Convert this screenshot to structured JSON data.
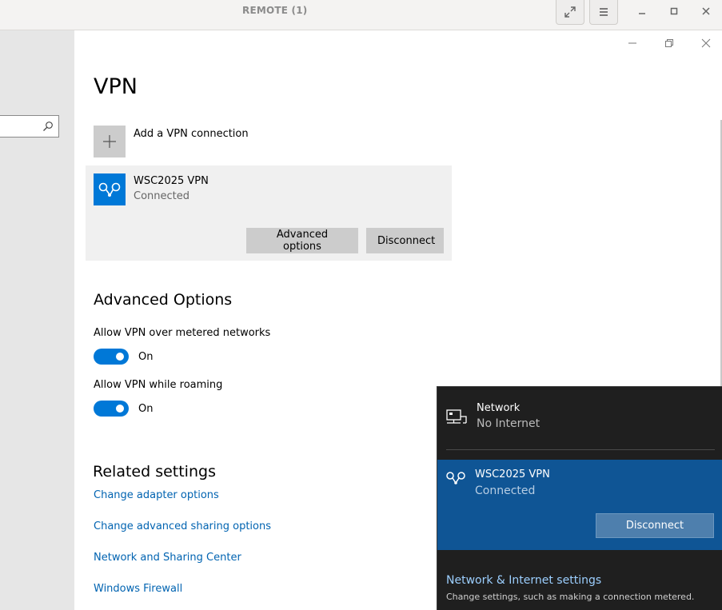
{
  "remote_bar": {
    "title": "REMOTE (1)"
  },
  "page": {
    "title": "VPN",
    "add_vpn_label": "Add a VPN connection",
    "vpn": {
      "name": "WSC2025 VPN",
      "status": "Connected",
      "advanced_button": "Advanced options",
      "disconnect_button": "Disconnect"
    },
    "advanced": {
      "title": "Advanced Options",
      "metered_label": "Allow VPN over metered networks",
      "metered_state": "On",
      "roaming_label": "Allow VPN while roaming",
      "roaming_state": "On"
    },
    "related": {
      "title": "Related settings",
      "links": [
        "Change adapter options",
        "Change advanced sharing options",
        "Network and Sharing Center",
        "Windows Firewall"
      ]
    }
  },
  "flyout": {
    "network_name": "Network",
    "network_status": "No Internet",
    "vpn_name": "WSC2025 VPN",
    "vpn_status": "Connected",
    "disconnect_button": "Disconnect",
    "settings_link": "Network & Internet settings",
    "settings_sub": "Change settings, such as making a connection metered."
  },
  "colors": {
    "accent": "#0078d7",
    "link": "#0063b1",
    "flyout_bg": "#1f1f1f",
    "flyout_vpn_bg": "#0f5595"
  },
  "icons": [
    "fullscreen-icon",
    "menu-icon",
    "minimize-icon",
    "maximize-icon",
    "close-icon",
    "search-icon",
    "plus-icon",
    "vpn-icon",
    "network-icon"
  ]
}
